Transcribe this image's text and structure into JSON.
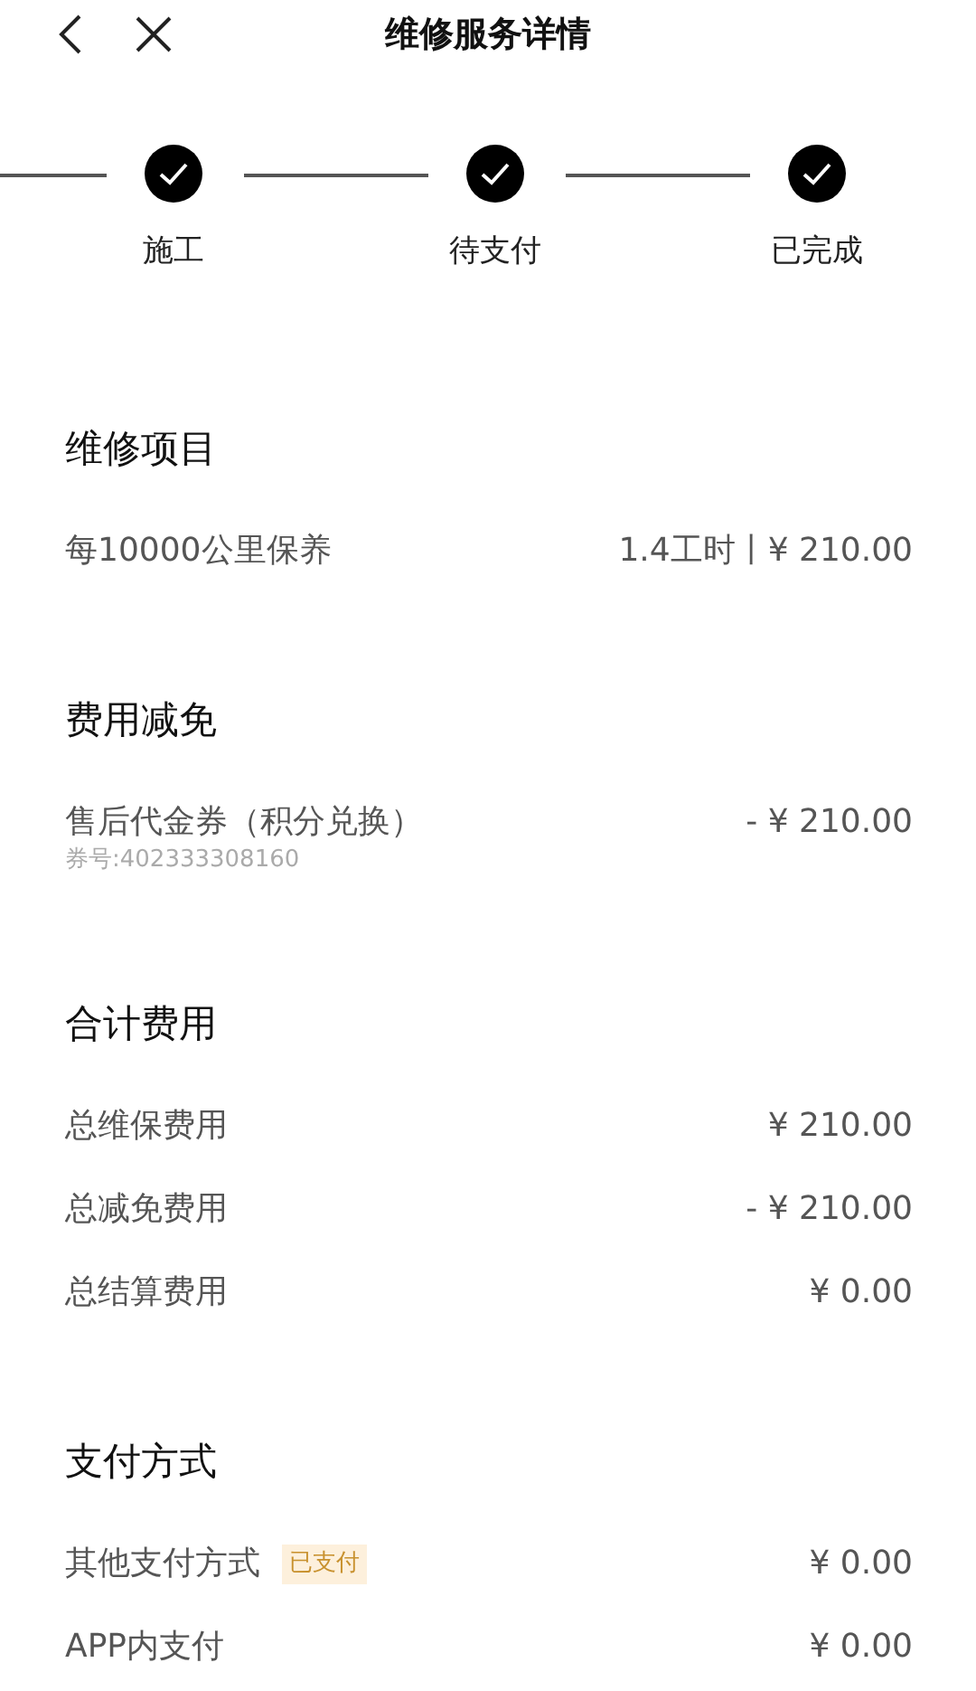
{
  "header": {
    "title": "维修服务详情"
  },
  "steps": [
    {
      "label": "施工",
      "completed": true
    },
    {
      "label": "待支付",
      "completed": true
    },
    {
      "label": "已完成",
      "completed": true
    }
  ],
  "sections": [
    {
      "title": "维修项目",
      "rows": [
        {
          "label": "每10000公里保养",
          "value": "1.4工时丨¥ 210.00"
        }
      ]
    },
    {
      "title": "费用减免",
      "rows": [
        {
          "label": "售后代金券（积分兑换）",
          "value": "- ¥ 210.00",
          "note": "券号:402333308160"
        }
      ]
    },
    {
      "title": "合计费用",
      "rows": [
        {
          "label": "总维保费用",
          "value": "¥ 210.00"
        },
        {
          "label": "总减免费用",
          "value": "- ¥ 210.00"
        },
        {
          "label": "总结算费用",
          "value": "¥ 0.00"
        }
      ]
    },
    {
      "title": "支付方式",
      "rows": [
        {
          "label": "其他支付方式",
          "value": "¥ 0.00",
          "badge": "已支付"
        },
        {
          "label": "APP内支付",
          "value": "¥ 0.00"
        }
      ]
    }
  ]
}
